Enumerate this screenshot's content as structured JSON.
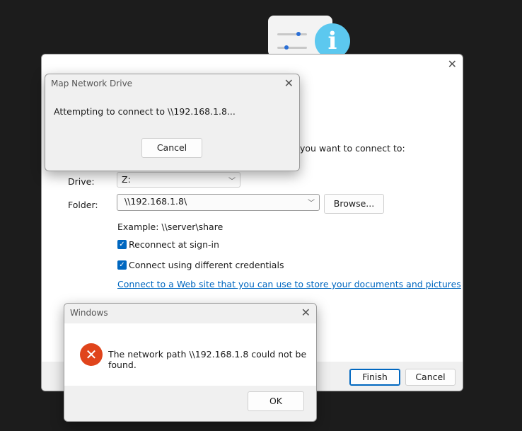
{
  "wizard": {
    "prompt_fragment": "you want to connect to:",
    "drive_label": "Drive:",
    "drive_value": "Z:",
    "folder_label": "Folder:",
    "folder_value": "\\\\192.168.1.8\\",
    "browse_label": "Browse...",
    "example_text": "Example: \\\\server\\share",
    "reconnect_label": "Reconnect at sign-in",
    "reconnect_checked": true,
    "credentials_label": "Connect using different credentials",
    "credentials_checked": true,
    "link_text": "Connect to a Web site that you can use to store your documents and pictures",
    "link_period": ".",
    "finish_label": "Finish",
    "cancel_label": "Cancel"
  },
  "progress_dialog": {
    "title": "Map Network Drive",
    "message": "Attempting to connect to \\\\192.168.1.8...",
    "cancel_label": "Cancel"
  },
  "error_dialog": {
    "title": "Windows",
    "message": "The network path \\\\192.168.1.8 could not be found.",
    "ok_label": "OK"
  },
  "icons": {
    "close": "close-icon",
    "chevron": "chevron-down-icon",
    "check": "checkmark-icon",
    "error": "error-icon",
    "info": "info-icon"
  },
  "colors": {
    "accent": "#0067c0",
    "error": "#e0441b",
    "info": "#5cc8ef"
  }
}
